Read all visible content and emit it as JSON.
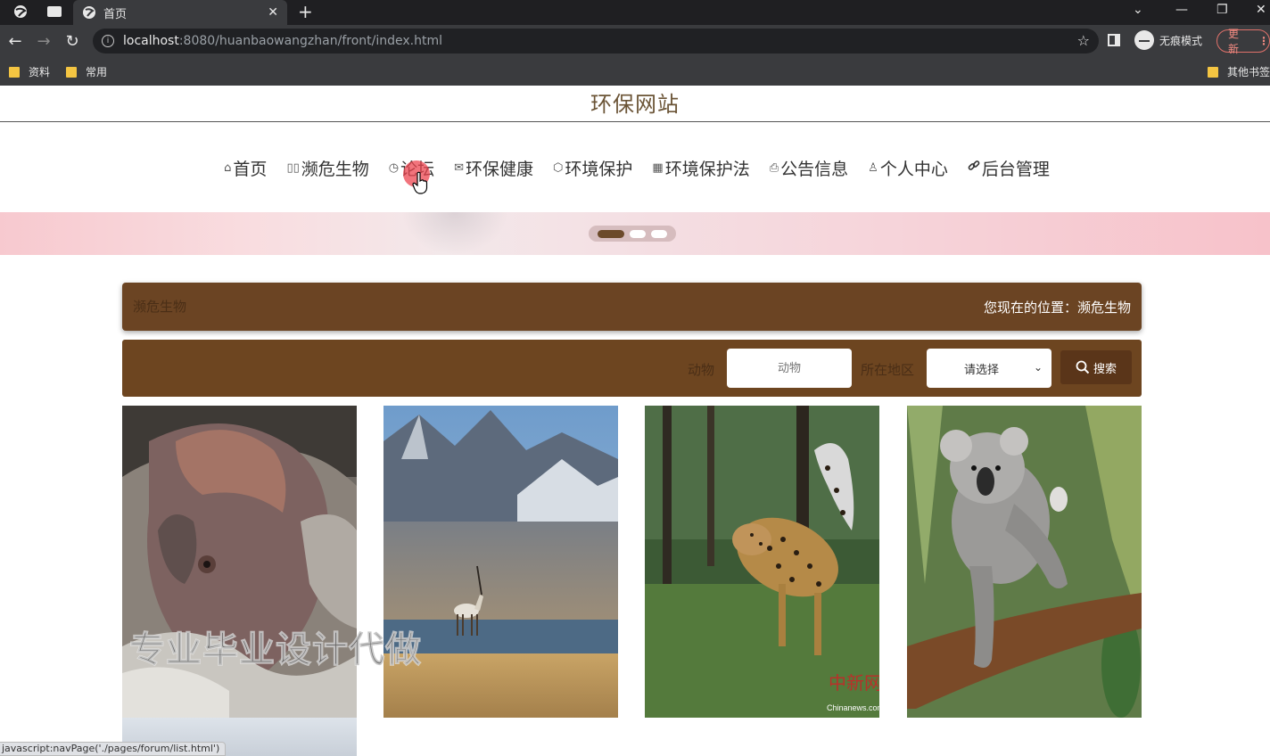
{
  "browser": {
    "tab_title": "首页",
    "url_host": "localhost",
    "url_rest": ":8080/huanbaowangzhan/front/index.html",
    "incognito_label": "无痕模式",
    "update_label": "更新",
    "bookmarks": [
      {
        "label": "资料"
      },
      {
        "label": "常用"
      }
    ],
    "other_bookmarks": "其他书签",
    "status_url": "javascript:navPage('./pages/forum/list.html')"
  },
  "site": {
    "title": "环保网站",
    "nav": [
      {
        "icon": "home-icon",
        "glyph": "⌂",
        "label": "首页"
      },
      {
        "icon": "species-icon",
        "glyph": "▯▯",
        "label": "濒危生物"
      },
      {
        "icon": "forum-icon",
        "glyph": "◷",
        "label": "论坛"
      },
      {
        "icon": "mail-icon",
        "glyph": "✉",
        "label": "环保健康"
      },
      {
        "icon": "tag-icon",
        "glyph": "⬡",
        "label": "环境保护"
      },
      {
        "icon": "grid-icon",
        "glyph": "▦",
        "label": "环境保护法"
      },
      {
        "icon": "printer-icon",
        "glyph": "⎙",
        "label": "公告信息"
      },
      {
        "icon": "user-icon",
        "glyph": "♙",
        "label": "个人中心"
      },
      {
        "icon": "link-icon",
        "glyph": "🔗",
        "label": "后台管理"
      }
    ],
    "carousel": {
      "count": 3,
      "active": 0
    }
  },
  "breadcrumb": {
    "section": "濒危生物",
    "location": "您现在的位置：濒危生物"
  },
  "search": {
    "animal_label": "动物",
    "animal_placeholder": "动物",
    "region_label": "所在地区",
    "region_selected": "请选择",
    "button_label": "搜索"
  },
  "cards": [
    {
      "name": "rhino-photo"
    },
    {
      "name": "antelope-photo"
    },
    {
      "name": "leopard-photo"
    },
    {
      "name": "koala-photo"
    }
  ],
  "watermark": "专业毕业设计代做",
  "photo_stamp": "中新网",
  "photo_stamp_sub": "Chinanews.com",
  "colors": {
    "header_brown": "#6b4423",
    "accent_brown": "#6d4520",
    "title_text": "#6b5436"
  }
}
